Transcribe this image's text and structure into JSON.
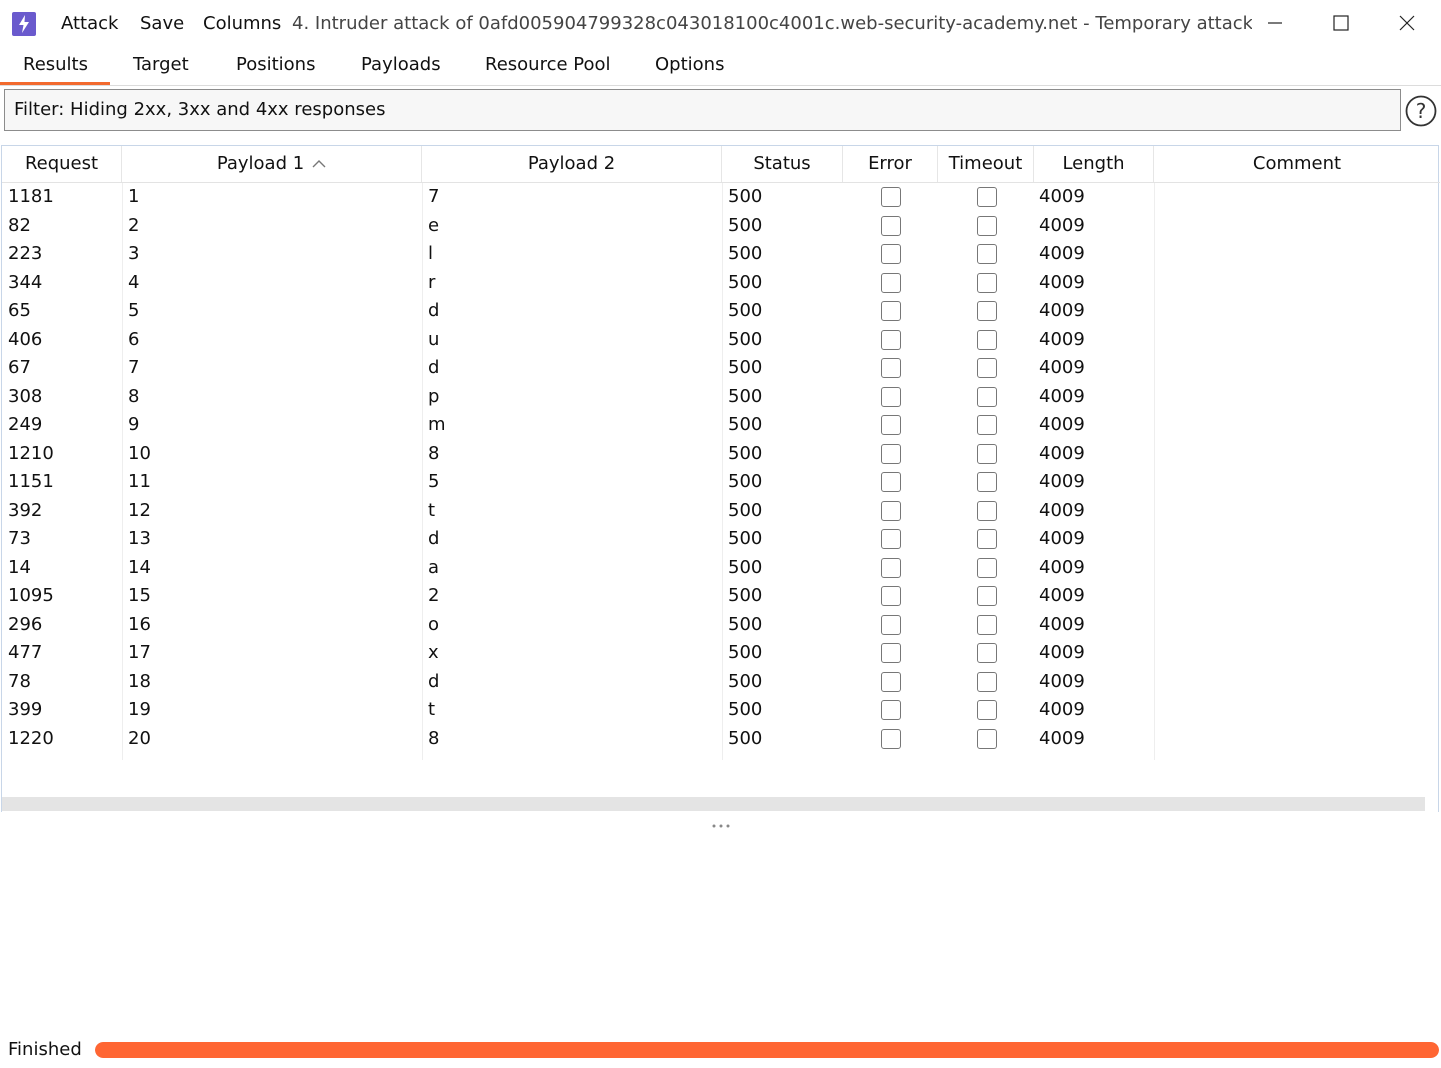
{
  "menu": {
    "attack": "Attack",
    "save": "Save",
    "columns": "Columns"
  },
  "window_title": "4. Intruder attack of 0afd005904799328c043018100c4001c.web-security-academy.net - Temporary attack - ...",
  "tabs": [
    "Results",
    "Target",
    "Positions",
    "Payloads",
    "Resource Pool",
    "Options"
  ],
  "active_tab": "Results",
  "filter": "Filter: Hiding 2xx, 3xx and 4xx responses",
  "columns": [
    "Request",
    "Payload 1",
    "Payload 2",
    "Status",
    "Error",
    "Timeout",
    "Length",
    "Comment"
  ],
  "sorted_column": "Payload 1",
  "sort_direction": "ascending",
  "rows": [
    {
      "request": "1181",
      "payload1": "1",
      "payload2": "7",
      "status": "500",
      "error": false,
      "timeout": false,
      "length": "4009",
      "comment": ""
    },
    {
      "request": "82",
      "payload1": "2",
      "payload2": "e",
      "status": "500",
      "error": false,
      "timeout": false,
      "length": "4009",
      "comment": ""
    },
    {
      "request": "223",
      "payload1": "3",
      "payload2": "l",
      "status": "500",
      "error": false,
      "timeout": false,
      "length": "4009",
      "comment": ""
    },
    {
      "request": "344",
      "payload1": "4",
      "payload2": "r",
      "status": "500",
      "error": false,
      "timeout": false,
      "length": "4009",
      "comment": ""
    },
    {
      "request": "65",
      "payload1": "5",
      "payload2": "d",
      "status": "500",
      "error": false,
      "timeout": false,
      "length": "4009",
      "comment": ""
    },
    {
      "request": "406",
      "payload1": "6",
      "payload2": "u",
      "status": "500",
      "error": false,
      "timeout": false,
      "length": "4009",
      "comment": ""
    },
    {
      "request": "67",
      "payload1": "7",
      "payload2": "d",
      "status": "500",
      "error": false,
      "timeout": false,
      "length": "4009",
      "comment": ""
    },
    {
      "request": "308",
      "payload1": "8",
      "payload2": "p",
      "status": "500",
      "error": false,
      "timeout": false,
      "length": "4009",
      "comment": ""
    },
    {
      "request": "249",
      "payload1": "9",
      "payload2": "m",
      "status": "500",
      "error": false,
      "timeout": false,
      "length": "4009",
      "comment": ""
    },
    {
      "request": "1210",
      "payload1": "10",
      "payload2": "8",
      "status": "500",
      "error": false,
      "timeout": false,
      "length": "4009",
      "comment": ""
    },
    {
      "request": "1151",
      "payload1": "11",
      "payload2": "5",
      "status": "500",
      "error": false,
      "timeout": false,
      "length": "4009",
      "comment": ""
    },
    {
      "request": "392",
      "payload1": "12",
      "payload2": "t",
      "status": "500",
      "error": false,
      "timeout": false,
      "length": "4009",
      "comment": ""
    },
    {
      "request": "73",
      "payload1": "13",
      "payload2": "d",
      "status": "500",
      "error": false,
      "timeout": false,
      "length": "4009",
      "comment": ""
    },
    {
      "request": "14",
      "payload1": "14",
      "payload2": "a",
      "status": "500",
      "error": false,
      "timeout": false,
      "length": "4009",
      "comment": ""
    },
    {
      "request": "1095",
      "payload1": "15",
      "payload2": "2",
      "status": "500",
      "error": false,
      "timeout": false,
      "length": "4009",
      "comment": ""
    },
    {
      "request": "296",
      "payload1": "16",
      "payload2": "o",
      "status": "500",
      "error": false,
      "timeout": false,
      "length": "4009",
      "comment": ""
    },
    {
      "request": "477",
      "payload1": "17",
      "payload2": "x",
      "status": "500",
      "error": false,
      "timeout": false,
      "length": "4009",
      "comment": ""
    },
    {
      "request": "78",
      "payload1": "18",
      "payload2": "d",
      "status": "500",
      "error": false,
      "timeout": false,
      "length": "4009",
      "comment": ""
    },
    {
      "request": "399",
      "payload1": "19",
      "payload2": "t",
      "status": "500",
      "error": false,
      "timeout": false,
      "length": "4009",
      "comment": ""
    },
    {
      "request": "1220",
      "payload1": "20",
      "payload2": "8",
      "status": "500",
      "error": false,
      "timeout": false,
      "length": "4009",
      "comment": ""
    }
  ],
  "status": "Finished",
  "progress": 1.0,
  "colors": {
    "accent": "#f26a2e",
    "progress": "#ff6633",
    "app_icon": "#6a5acd"
  },
  "icons": {
    "app": "burp-lightning-icon",
    "help": "help-circle-icon",
    "sort": "chevron-up-icon",
    "minimize": "minimize-icon",
    "maximize": "maximize-icon",
    "close": "close-icon"
  }
}
